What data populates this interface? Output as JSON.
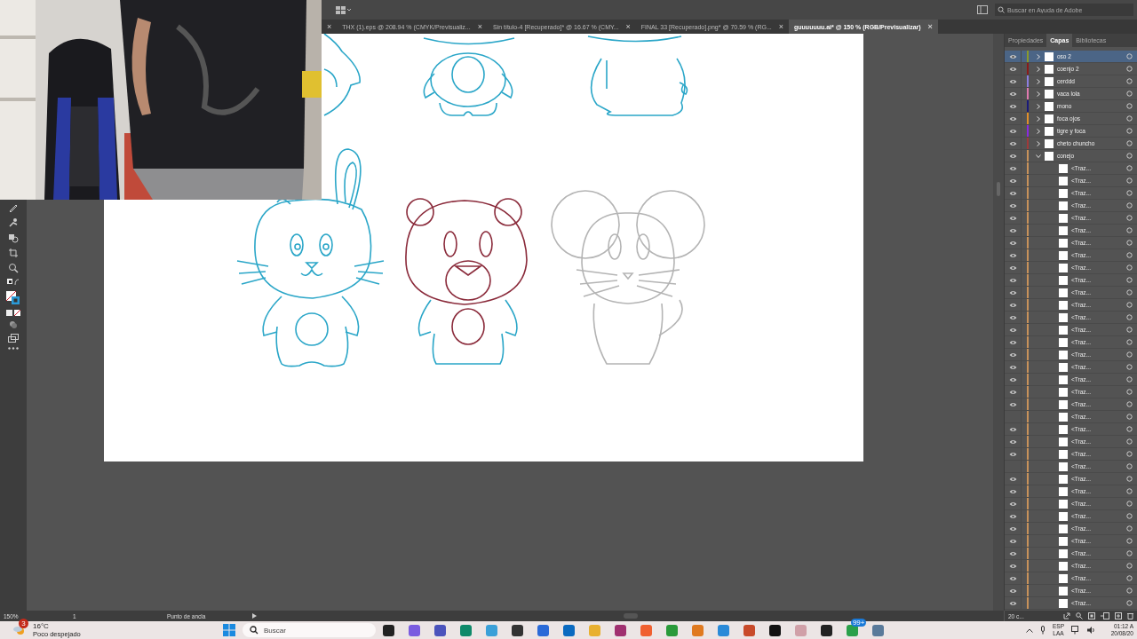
{
  "app_bar": {
    "search": {
      "placeholder": "Buscar en Ayuda de Adobe"
    }
  },
  "document_tabs": [
    {
      "close": "×",
      "selected": false
    },
    {
      "label": "THX (1).eps @ 208.94 % (CMYK/Previsualiz...",
      "close": "×",
      "selected": false
    },
    {
      "label": "Sin título-4 [Recuperado]* @ 16.67 % (CMY...",
      "close": "×",
      "selected": false
    },
    {
      "label": "FINAL 33 [Recuperado].png* @ 70.59 % (RG...",
      "close": "×",
      "selected": false
    },
    {
      "label": "guuuuuuu.ai* @ 150 % (RGB/Previsualizar)",
      "close": "×",
      "selected": true
    }
  ],
  "panel_tabs": [
    {
      "label": "Propiedades",
      "selected": false
    },
    {
      "label": "Capas",
      "selected": true
    },
    {
      "label": "Bibliotecas",
      "selected": false
    }
  ],
  "layers": [
    {
      "name": "oso 2",
      "color": "#8a9a2a",
      "visible": true,
      "selected": true,
      "expanded": false
    },
    {
      "name": "coenjo 2",
      "color": "#8b1a1a",
      "visible": true,
      "selected": false,
      "expanded": false
    },
    {
      "name": "cerddd",
      "color": "#8c7ee0",
      "visible": true,
      "selected": false,
      "expanded": false
    },
    {
      "name": "vaca lola",
      "color": "#e07ab0",
      "visible": true,
      "selected": false,
      "expanded": false
    },
    {
      "name": "mono",
      "color": "#1a1a7a",
      "visible": true,
      "selected": false,
      "expanded": false
    },
    {
      "name": "foca ojos",
      "color": "#e0902a",
      "visible": true,
      "selected": false,
      "expanded": false
    },
    {
      "name": "tigre y foca",
      "color": "#8a2ae0",
      "visible": true,
      "selected": false,
      "expanded": false
    },
    {
      "name": "cheto chuncho",
      "color": "#a03a3a",
      "visible": true,
      "selected": false,
      "expanded": false
    },
    {
      "name": "conejo",
      "color": "#c8925a",
      "visible": true,
      "selected": false,
      "expanded": true,
      "children": [
        {
          "name": "<Traz...",
          "visible": true
        },
        {
          "name": "<Traz...",
          "visible": true
        },
        {
          "name": "<Traz...",
          "visible": true
        },
        {
          "name": "<Traz...",
          "visible": true
        },
        {
          "name": "<Traz...",
          "visible": true
        },
        {
          "name": "<Traz...",
          "visible": true
        },
        {
          "name": "<Traz...",
          "visible": true
        },
        {
          "name": "<Traz...",
          "visible": true
        },
        {
          "name": "<Traz...",
          "visible": true
        },
        {
          "name": "<Traz...",
          "visible": true
        },
        {
          "name": "<Traz...",
          "visible": true
        },
        {
          "name": "<Traz...",
          "visible": true
        },
        {
          "name": "<Traz...",
          "visible": true
        },
        {
          "name": "<Traz...",
          "visible": true
        },
        {
          "name": "<Traz...",
          "visible": true
        },
        {
          "name": "<Traz...",
          "visible": true
        },
        {
          "name": "<Traz...",
          "visible": true
        },
        {
          "name": "<Traz...",
          "visible": true
        },
        {
          "name": "<Traz...",
          "visible": true
        },
        {
          "name": "<Traz...",
          "visible": true
        },
        {
          "name": "<Traz...",
          "visible": false
        },
        {
          "name": "<Traz...",
          "visible": true
        },
        {
          "name": "<Traz...",
          "visible": true
        },
        {
          "name": "<Traz...",
          "visible": true
        },
        {
          "name": "<Traz...",
          "visible": false
        },
        {
          "name": "<Traz...",
          "visible": true
        },
        {
          "name": "<Traz...",
          "visible": true
        },
        {
          "name": "<Traz...",
          "visible": true
        },
        {
          "name": "<Traz...",
          "visible": true
        },
        {
          "name": "<Traz...",
          "visible": true
        },
        {
          "name": "<Traz...",
          "visible": true
        },
        {
          "name": "<Traz...",
          "visible": true
        },
        {
          "name": "<Traz...",
          "visible": true
        },
        {
          "name": "<Traz...",
          "visible": true
        },
        {
          "name": "<Traz...",
          "visible": true
        },
        {
          "name": "<Traz...",
          "visible": true
        }
      ]
    }
  ],
  "layers_footer": "20 c...",
  "status_bar": {
    "zoom": "150%",
    "artboard": "1",
    "tool": "Punto de ancla"
  },
  "taskbar": {
    "weather": {
      "badge": "3",
      "temperature": "16°C",
      "condition": "Poco despejado"
    },
    "search": {
      "placeholder": "Buscar"
    },
    "notification_badge": "99+",
    "language": "ESP",
    "region": "LAA",
    "time": "01:12 A",
    "date": "20/08/20"
  }
}
